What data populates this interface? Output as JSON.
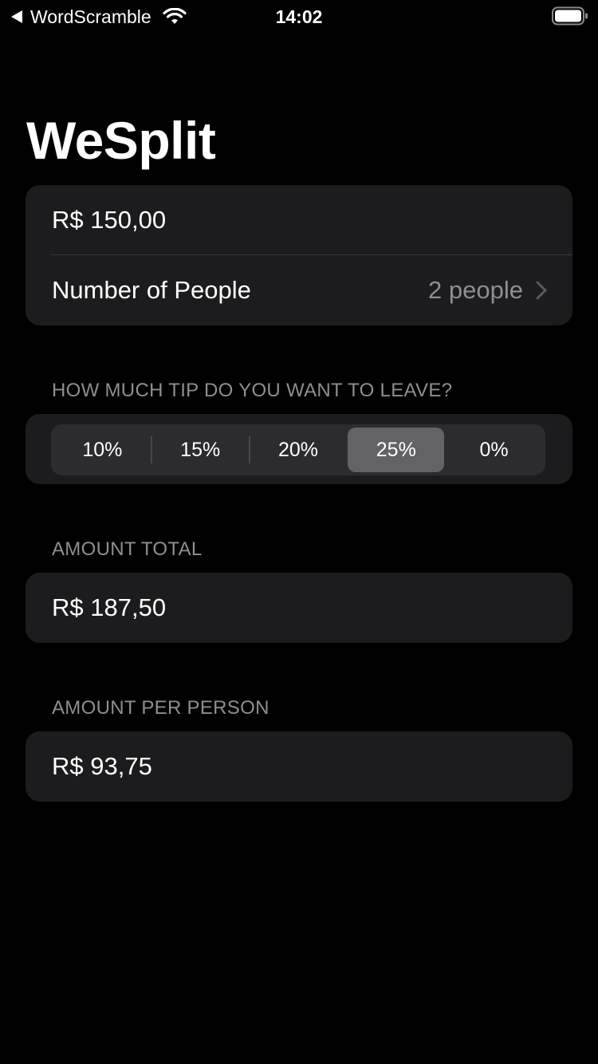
{
  "status_bar": {
    "back_app": "WordScramble",
    "time": "14:02"
  },
  "title": "WeSplit",
  "check": {
    "amount": "R$ 150,00",
    "people_label": "Number of People",
    "people_value": "2 people"
  },
  "tip": {
    "header": "HOW MUCH TIP DO YOU WANT TO LEAVE?",
    "options": [
      "10%",
      "15%",
      "20%",
      "25%",
      "0%"
    ],
    "selected": "25%"
  },
  "total": {
    "header": "AMOUNT TOTAL",
    "value": "R$ 187,50"
  },
  "per_person": {
    "header": "AMOUNT PER PERSON",
    "value": "R$ 93,75"
  },
  "colors": {
    "background": "#000000",
    "card": "#1c1c1e",
    "secondary_text": "#8e8e93",
    "segment_selected": "#636366"
  }
}
